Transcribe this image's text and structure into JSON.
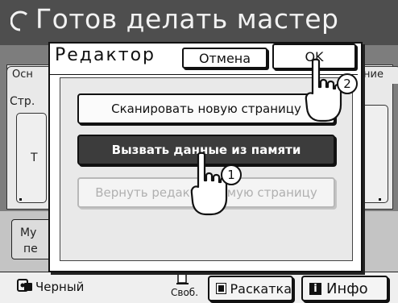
{
  "screen": {
    "title": "Готов делать мастер",
    "title_icon": "circle-outline-icon"
  },
  "background": {
    "tab_left_label": "Осн",
    "tab_right_label": "ние",
    "page_label": "Стр.",
    "slot_label": "Т",
    "bottom_button_label_1": "Му",
    "bottom_button_label_2": "пе"
  },
  "status_bar": {
    "color_label": "Черный",
    "color_icon": "ink-drum-icon",
    "free_label": "Своб.",
    "free_icon": "paper-icon",
    "raskatka_label": "Раскатка",
    "info_label": "Инфо"
  },
  "dialog": {
    "title": "Редактор",
    "cancel_label": "Отмена",
    "ok_label": "OK",
    "options": [
      {
        "label": "Сканировать новую страницу",
        "state": "normal"
      },
      {
        "label": "Вызвать данные из памяти",
        "state": "selected"
      },
      {
        "label": "Вернуть редактируемую страницу",
        "state": "disabled"
      }
    ]
  },
  "annotations": {
    "step_1": "1",
    "step_2": "2"
  },
  "colors": {
    "header_bg": "#4e4e4e",
    "selected_bg": "#3c3c3c",
    "disabled_text": "#b0b0b0"
  }
}
